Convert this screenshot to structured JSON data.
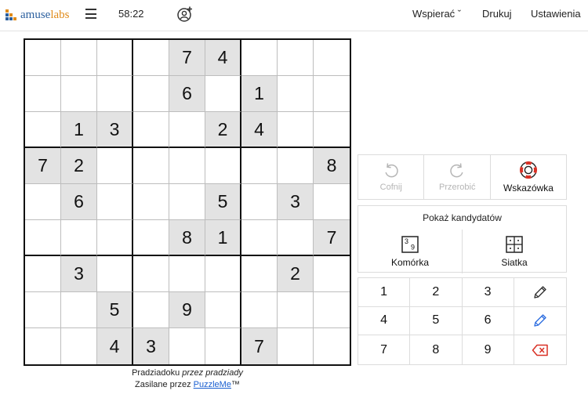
{
  "header": {
    "logo_part1": "amuse",
    "logo_part2": "labs",
    "timer": "58:22",
    "menu_support": "Wspierać ˇ",
    "menu_print": "Drukuj",
    "menu_settings": "Ustawienia"
  },
  "grid": [
    [
      "",
      "",
      "",
      "",
      "7",
      "4",
      "",
      "",
      ""
    ],
    [
      "",
      "",
      "",
      "",
      "6",
      "",
      "1",
      "",
      ""
    ],
    [
      "",
      "1",
      "3",
      "",
      "",
      "2",
      "4",
      "",
      ""
    ],
    [
      "7",
      "2",
      "",
      "",
      "",
      "",
      "",
      "",
      "8"
    ],
    [
      "",
      "6",
      "",
      "",
      "",
      "5",
      "",
      "3",
      ""
    ],
    [
      "",
      "",
      "",
      "",
      "8",
      "1",
      "",
      "",
      "7"
    ],
    [
      "",
      "3",
      "",
      "",
      "",
      "",
      "",
      "2",
      ""
    ],
    [
      "",
      "",
      "5",
      "",
      "9",
      "",
      "",
      "",
      ""
    ],
    [
      "",
      "",
      "4",
      "3",
      "",
      "",
      "7",
      "",
      ""
    ]
  ],
  "credits": {
    "title": "Pradziadoku",
    "by_word": "przez pradziady",
    "powered_prefix": "Zasilane przez",
    "powered_link": "PuzzleMe",
    "trademark": "™"
  },
  "tools": {
    "undo_label": "Cofnij",
    "redo_label": "Przerobić",
    "hint_label": "Wskazówka"
  },
  "candidates": {
    "title": "Pokaż kandydatów",
    "cell_label": "Komórka",
    "grid_label": "Siatka",
    "cell_icon_top": "3",
    "cell_icon_bottom": "9"
  },
  "keypad": {
    "digits": [
      "1",
      "2",
      "3",
      "4",
      "5",
      "6",
      "7",
      "8",
      "9"
    ]
  },
  "colors": {
    "given_bg": "#e3e3e3",
    "accent_blue": "#2f6fe0",
    "hint_red": "#d93025"
  }
}
